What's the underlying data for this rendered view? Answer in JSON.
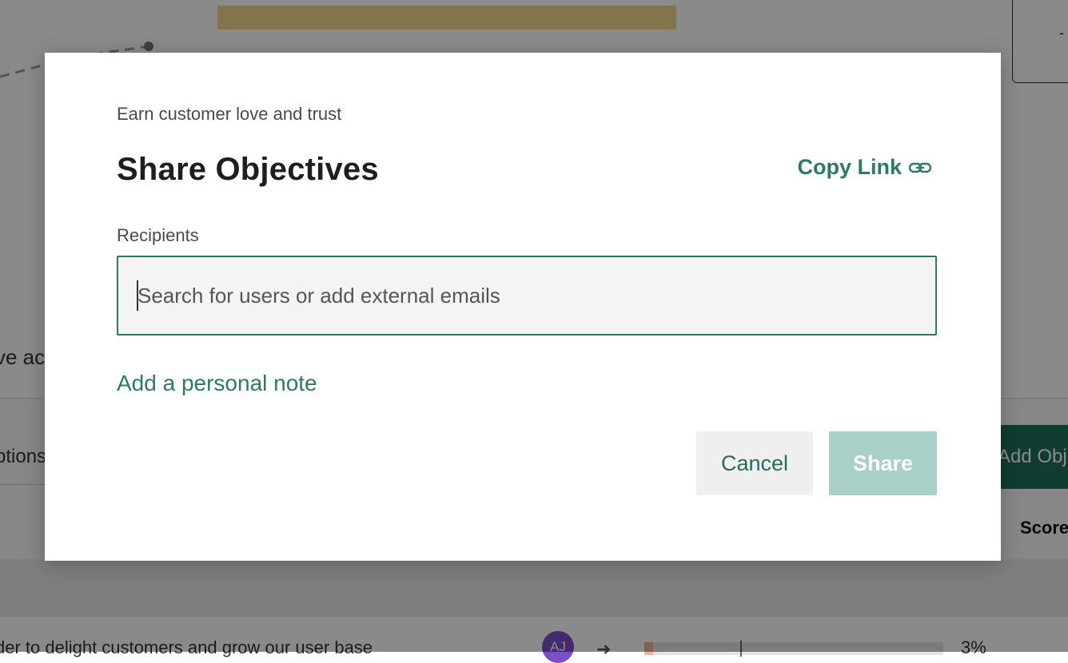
{
  "background": {
    "card_dash": "-",
    "truncated_text": "ve ac",
    "options_text": "ptions",
    "add_objective_label": "Add Obje",
    "score_header": "Score",
    "row_text": "der to delight customers and grow our user base",
    "avatar_initials": "AJ",
    "progress_percent": "3%",
    "progress_fraction": 0.03
  },
  "modal": {
    "subtitle": "Earn customer love and trust",
    "title": "Share Objectives",
    "copy_link_label": "Copy Link",
    "copy_link_icon": "link-icon",
    "recipients_label": "Recipients",
    "search_placeholder": "Search for users or add external emails",
    "search_value": "",
    "personal_note_label": "Add a personal note",
    "cancel_label": "Cancel",
    "share_label": "Share"
  },
  "colors": {
    "accent": "#2b7a68",
    "share_disabled": "#a8cfc8",
    "overlay": "rgba(0,0,0,0.46)"
  }
}
